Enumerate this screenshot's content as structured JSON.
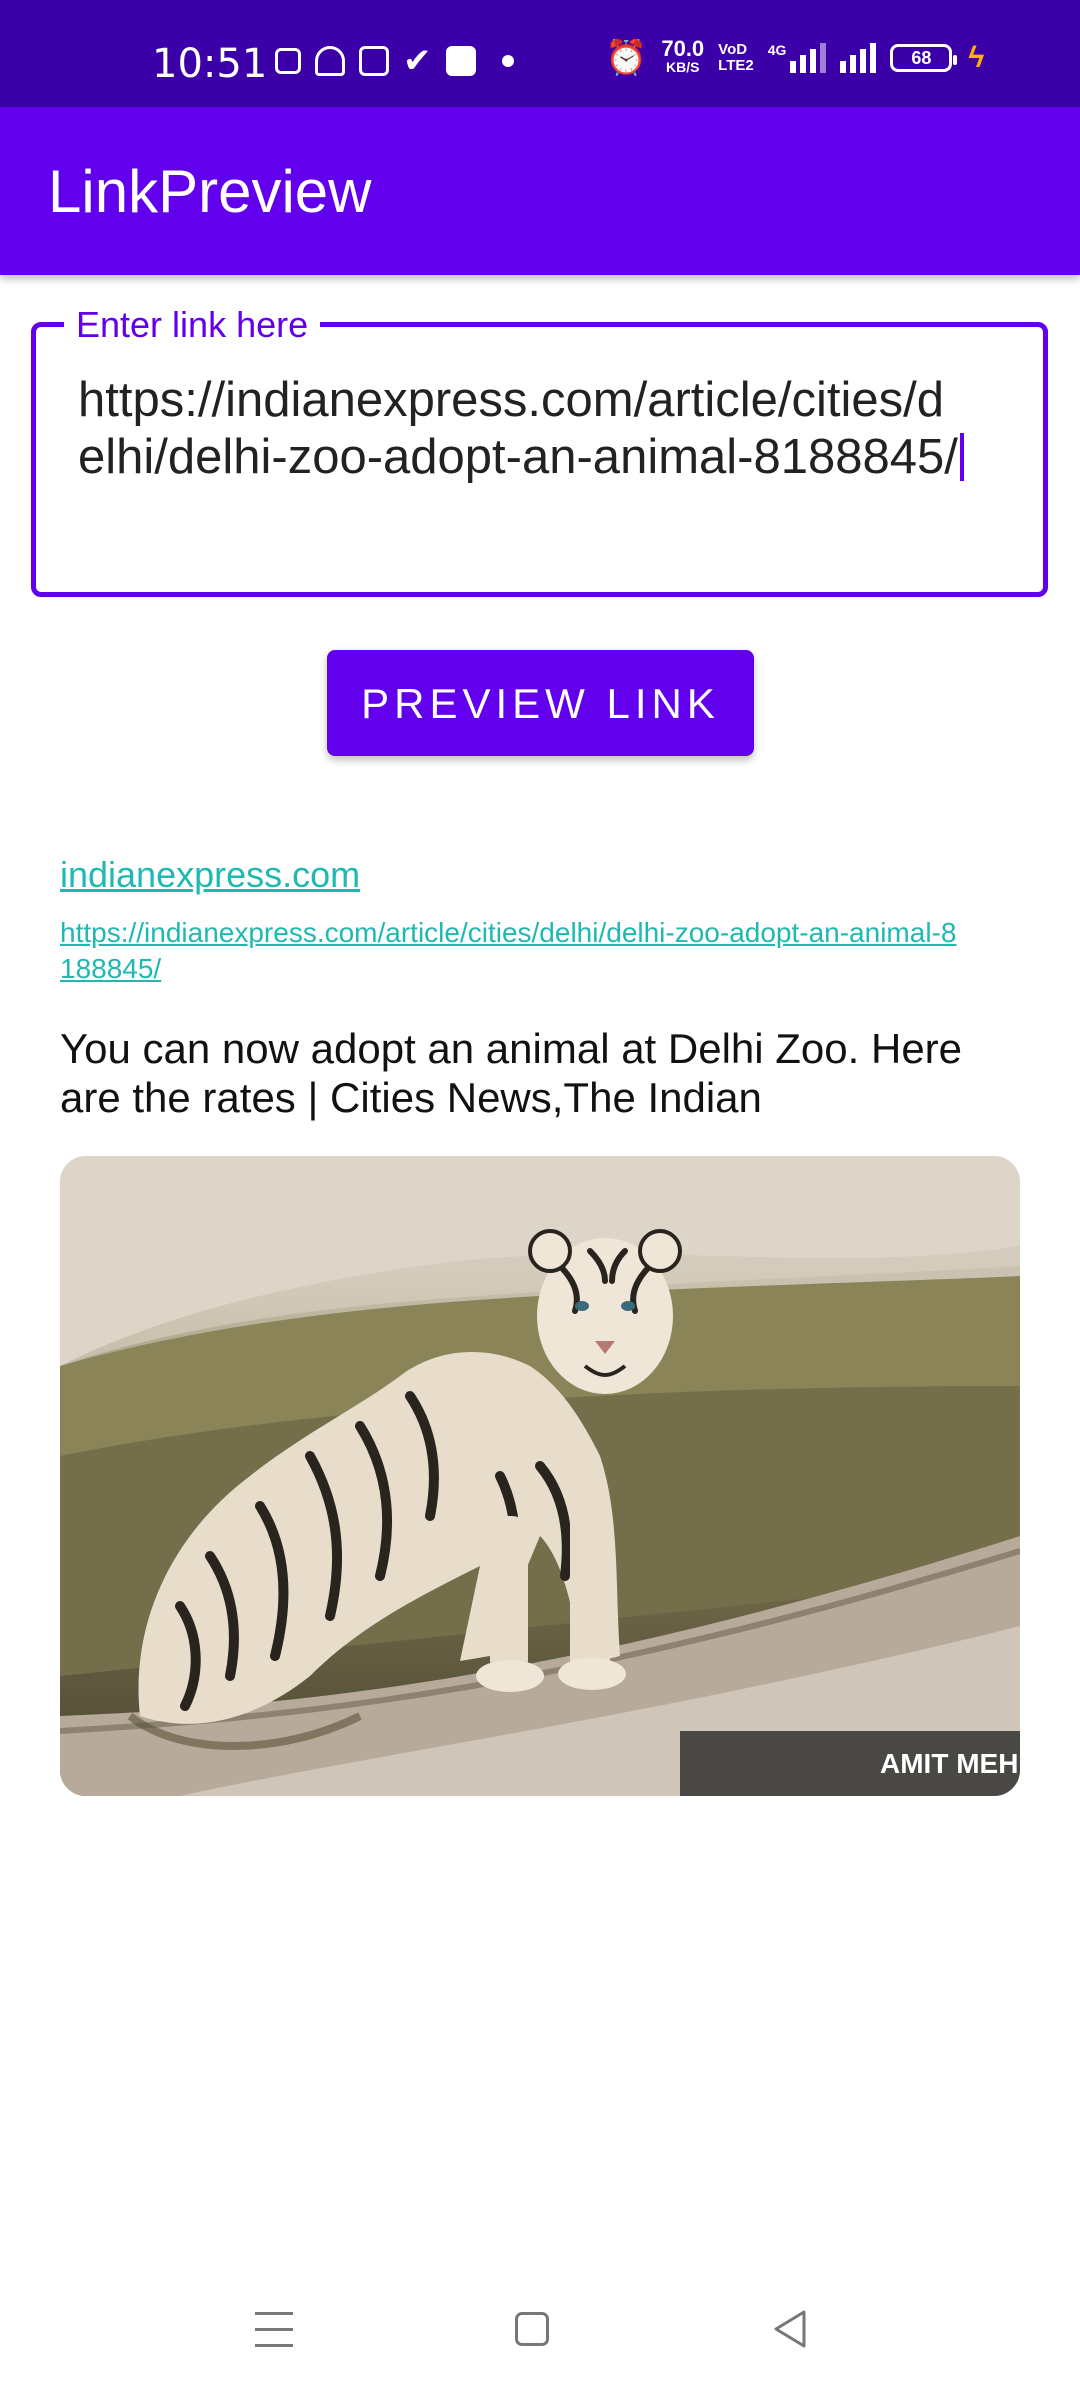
{
  "status_bar": {
    "time": "10:51",
    "net_speed_value": "70.0",
    "net_speed_unit": "KB/S",
    "volte_top": "VoD",
    "volte_bottom": "LTE2",
    "network": "4G",
    "battery": "68"
  },
  "app_bar": {
    "title": "LinkPreview"
  },
  "link_input": {
    "label": "Enter link here",
    "value": "https://indianexpress.com/article/cities/delhi/delhi-zoo-adopt-an-animal-8188845/"
  },
  "preview_button": {
    "label": "PREVIEW LINK"
  },
  "preview": {
    "domain": "indianexpress.com",
    "url": "https://indianexpress.com/article/cities/delhi/delhi-zoo-adopt-an-animal-8188845/",
    "title": "You can now adopt an animal at Delhi Zoo. Here are the rates | Cities News,The Indian",
    "image_credit": "AMIT MEH"
  },
  "nav_bar": {
    "icons": [
      "menu-icon",
      "home-icon",
      "back-icon"
    ]
  },
  "colors": {
    "status_bar": "#3b00a8",
    "primary": "#6200ee",
    "link": "#1fb9b2"
  }
}
